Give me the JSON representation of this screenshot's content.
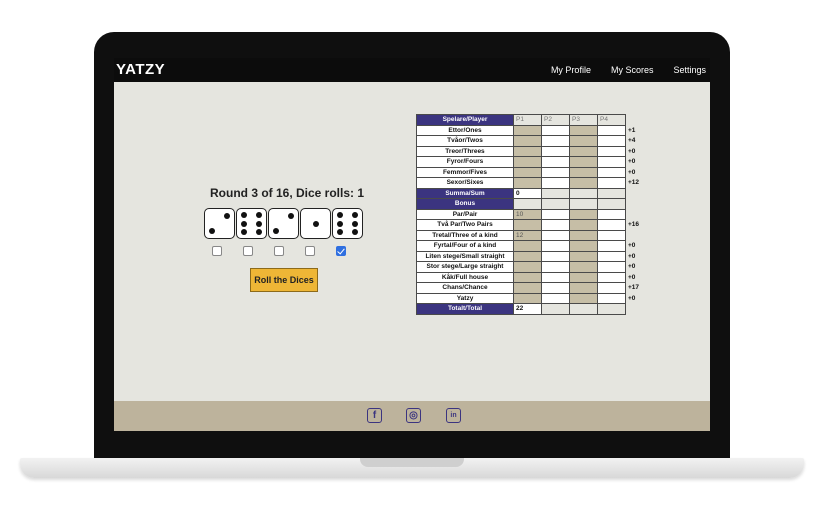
{
  "app": {
    "logo": "YATZY"
  },
  "nav": {
    "items": [
      "My Profile",
      "My Scores",
      "Settings"
    ]
  },
  "game": {
    "round_text": "Round 3 of 16, Dice rolls: 1",
    "dice": [
      2,
      6,
      2,
      1,
      6
    ],
    "held": [
      false,
      false,
      false,
      false,
      true
    ],
    "roll_button": "Roll the Dices"
  },
  "scorecard": {
    "header": {
      "label": "Spelare/Player",
      "players": [
        "P1",
        "P2",
        "P3",
        "P4"
      ]
    },
    "upper": [
      {
        "label": "Ettor/Ones",
        "p1": "",
        "bonus": "+1"
      },
      {
        "label": "Tvåor/Twos",
        "p1": "",
        "bonus": "+4"
      },
      {
        "label": "Treor/Threes",
        "p1": "",
        "bonus": "+0"
      },
      {
        "label": "Fyror/Fours",
        "p1": "",
        "bonus": "+0"
      },
      {
        "label": "Femmor/Fives",
        "p1": "",
        "bonus": "+0"
      },
      {
        "label": "Sexor/Sixes",
        "p1": "",
        "bonus": "+12"
      }
    ],
    "sum": {
      "label": "Summa/Sum",
      "p1": "0"
    },
    "bonus_row": {
      "label": "Bonus",
      "p1": ""
    },
    "lower": [
      {
        "label": "Par/Pair",
        "p1": "10",
        "bonus": ""
      },
      {
        "label": "Två Par/Two Pairs",
        "p1": "",
        "bonus": "+16"
      },
      {
        "label": "Tretal/Three of a kind",
        "p1": "12",
        "bonus": ""
      },
      {
        "label": "Fyrtal/Four of a kind",
        "p1": "",
        "bonus": "+0"
      },
      {
        "label": "Liten stege/Small straight",
        "p1": "",
        "bonus": "+0",
        "tall": true
      },
      {
        "label": "Stor stege/Large straight",
        "p1": "",
        "bonus": "+0",
        "tall": true
      },
      {
        "label": "Kåk/Full house",
        "p1": "",
        "bonus": "+0"
      },
      {
        "label": "Chans/Chance",
        "p1": "",
        "bonus": "+17"
      },
      {
        "label": "Yatzy",
        "p1": "",
        "bonus": "+0"
      }
    ],
    "total": {
      "label": "Totalt/Total",
      "p1": "22"
    }
  },
  "footer": {
    "icons": [
      "facebook-icon",
      "instagram-icon",
      "linkedin-icon"
    ],
    "glyphs": [
      "f",
      "◎",
      "in"
    ]
  },
  "colors": {
    "header_purple": "#3b3480",
    "column_tan": "#c6bea6",
    "button_yellow": "#eeb636",
    "footer_tan": "#bdb39c"
  }
}
